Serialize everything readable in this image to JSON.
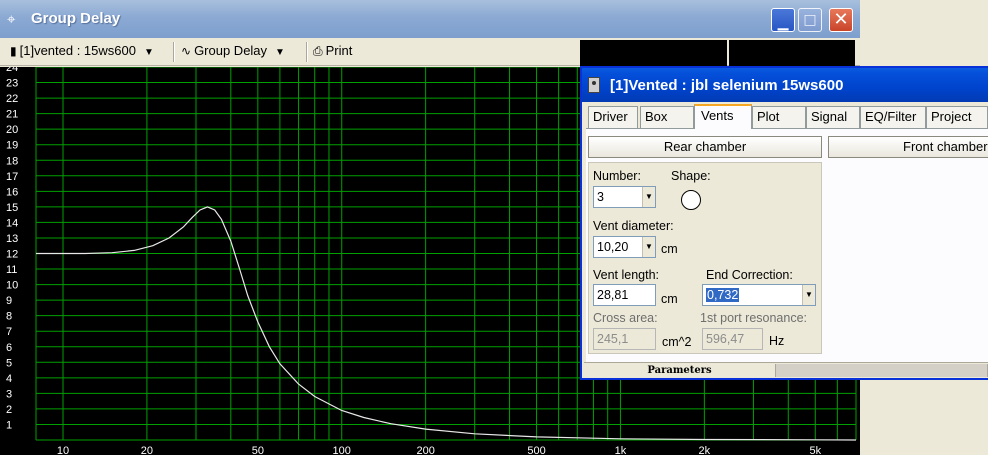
{
  "group_delay_window": {
    "title": "Group Delay",
    "title_icon": "crosshair-icon",
    "toolbar": {
      "project_selector": "[1]vented : 15ws600",
      "graph_selector": "Group Delay",
      "print_label": "Print"
    },
    "colors": {
      "plot_bg": "#000000",
      "grid": "#00a000",
      "curve": "#e8e8e8",
      "tick_label": "#ffffff"
    }
  },
  "chart_data": {
    "type": "line",
    "xscale": "log",
    "ylim": [
      0,
      24
    ],
    "xlim": [
      8,
      7000
    ],
    "y_ticks": [
      "24",
      "23",
      "22",
      "21",
      "20",
      "19",
      "18",
      "17",
      "16",
      "15",
      "14",
      "13",
      "12",
      "11",
      "10",
      "9",
      "8",
      "7",
      "6",
      "5",
      "4",
      "3",
      "2",
      "1"
    ],
    "x_tick_labels": [
      "10",
      "20",
      "50",
      "100",
      "200",
      "500",
      "1k",
      "2k",
      "5k"
    ],
    "x_tick_values": [
      10,
      20,
      50,
      100,
      200,
      500,
      1000,
      2000,
      5000
    ],
    "grid": true,
    "series": [
      {
        "x": [
          8,
          12,
          15,
          18,
          21,
          24,
          27,
          29,
          31,
          33,
          35,
          37,
          40,
          43,
          46,
          50,
          55,
          60,
          70,
          80,
          100,
          120,
          150,
          200,
          300,
          500,
          1000,
          2000,
          5000,
          7000
        ],
        "y": [
          12.0,
          12.0,
          12.05,
          12.2,
          12.5,
          13.0,
          13.7,
          14.3,
          14.8,
          15.0,
          14.8,
          14.2,
          12.8,
          11.0,
          9.3,
          7.6,
          6.0,
          4.9,
          3.6,
          2.8,
          1.9,
          1.45,
          1.05,
          0.7,
          0.4,
          0.2,
          0.08,
          0.03,
          0.01,
          0.0
        ]
      }
    ]
  },
  "vented_dialog": {
    "title": "[1]Vented : jbl selenium 15ws600",
    "tabs": [
      "Driver",
      "Box",
      "Vents",
      "Plot",
      "Signal",
      "EQ/Filter",
      "Project"
    ],
    "active_tab": "Vents",
    "rear_chamber_label": "Rear chamber",
    "front_chamber_label": "Front chamber",
    "number": {
      "label": "Number:",
      "value": "3"
    },
    "shape": {
      "label": "Shape:",
      "value": "circle"
    },
    "vent_diameter": {
      "label": "Vent diameter:",
      "value": "10,20",
      "unit": "cm"
    },
    "vent_length": {
      "label": "Vent length:",
      "value": "28,81",
      "unit": "cm"
    },
    "end_correction": {
      "label": "End Correction:",
      "value": "0,732"
    },
    "cross_area": {
      "label": "Cross area:",
      "value": "245,1",
      "unit": "cm^2"
    },
    "port_resonance": {
      "label": "1st port resonance:",
      "value": "596,47",
      "unit": "Hz"
    },
    "status": {
      "parameters_label": "Parameters"
    }
  }
}
